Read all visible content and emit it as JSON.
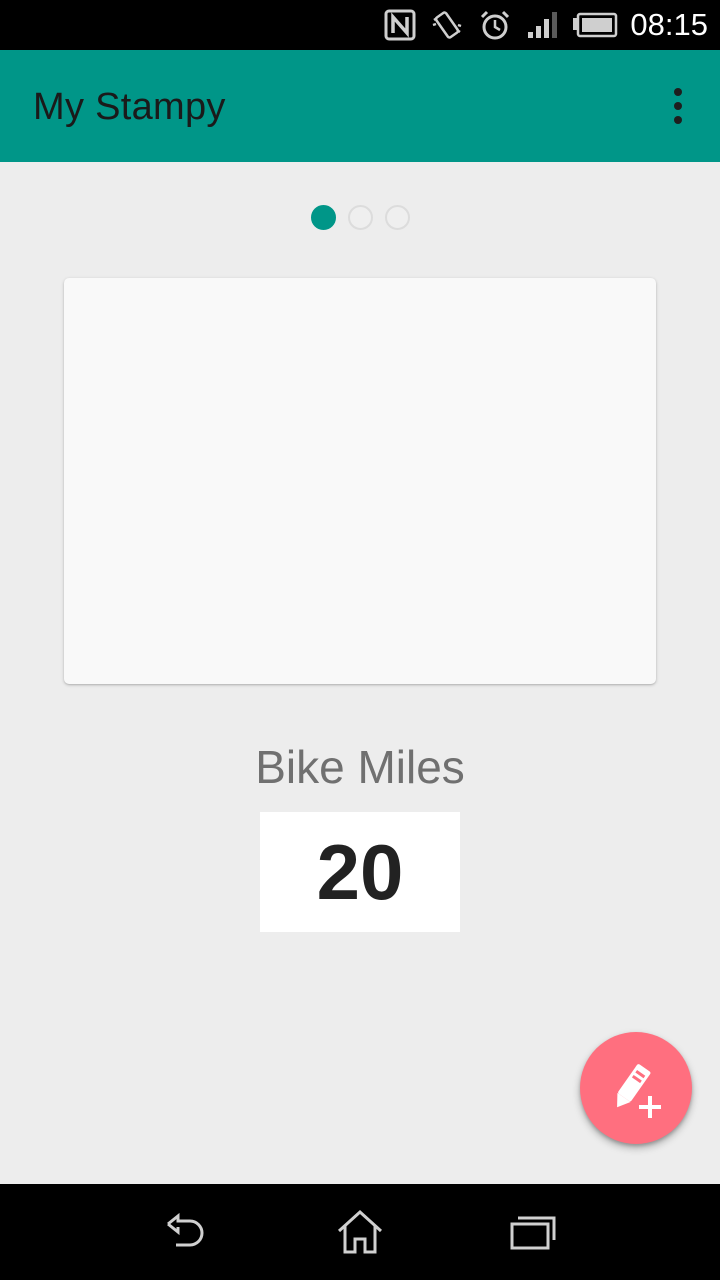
{
  "status_bar": {
    "time": "08:15",
    "icons": [
      "nfc-icon",
      "vibrate-icon",
      "alarm-icon",
      "signal-icon",
      "battery-icon"
    ]
  },
  "app_bar": {
    "title": "My Stampy",
    "menu_icon": "overflow-menu-icon",
    "background": "#009688"
  },
  "pager": {
    "count": 3,
    "active_index": 0
  },
  "card": {
    "title": "Bike Miles",
    "count": "20"
  },
  "fab": {
    "icon": "edit-add-icon",
    "color": "#ff6f7f"
  },
  "nav_bar": {
    "buttons": [
      "back-icon",
      "home-icon",
      "recents-icon"
    ]
  }
}
